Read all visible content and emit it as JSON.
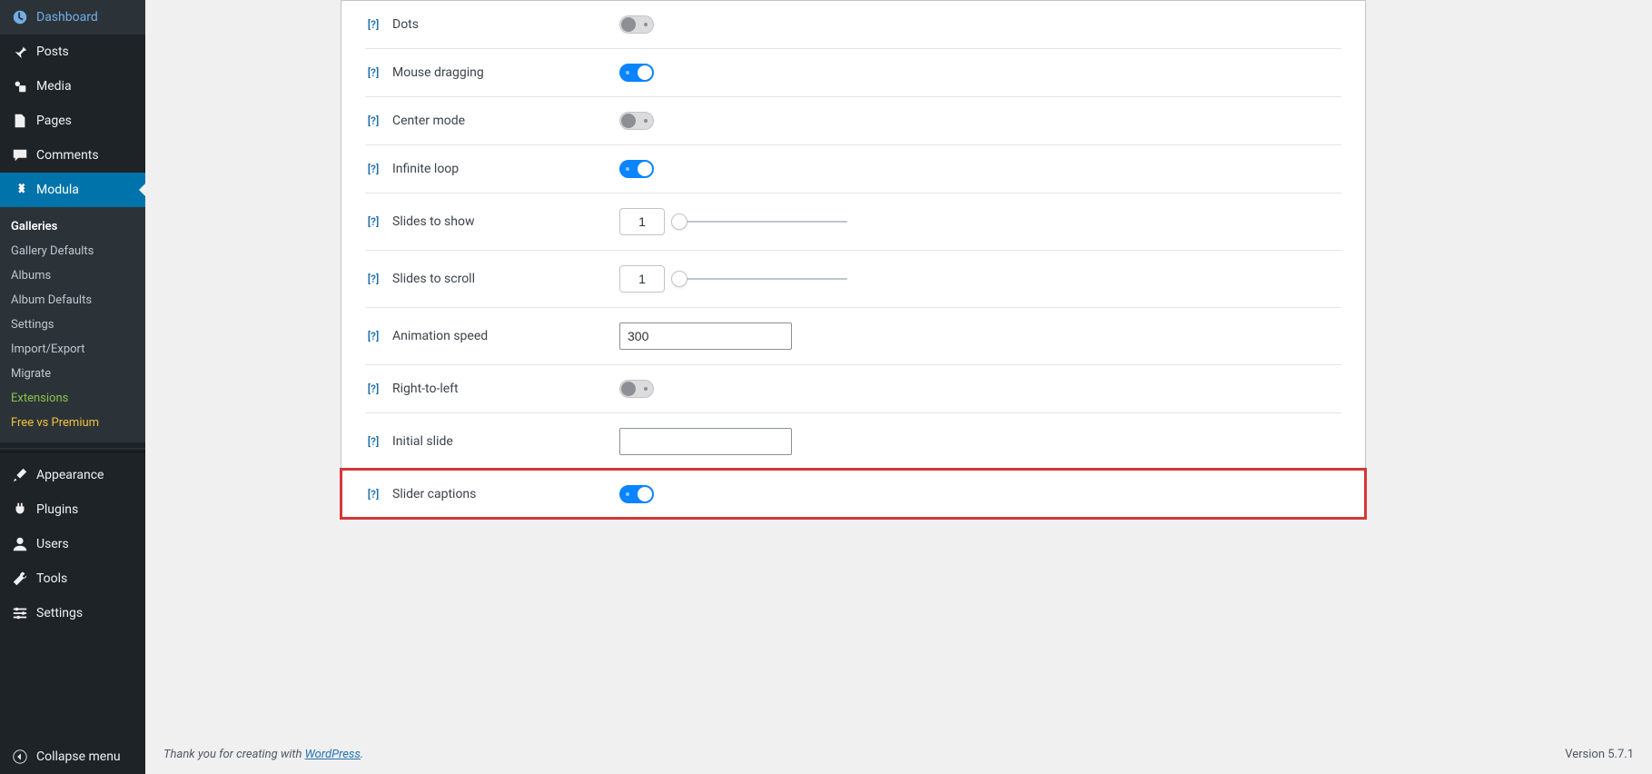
{
  "sidebar": {
    "dashboard": "Dashboard",
    "posts": "Posts",
    "media": "Media",
    "pages": "Pages",
    "comments": "Comments",
    "modula": "Modula",
    "submenu": {
      "galleries": "Galleries",
      "gallery_defaults": "Gallery Defaults",
      "albums": "Albums",
      "album_defaults": "Album Defaults",
      "settings": "Settings",
      "import_export": "Import/Export",
      "migrate": "Migrate",
      "extensions": "Extensions",
      "free_vs_premium": "Free vs Premium"
    },
    "appearance": "Appearance",
    "plugins": "Plugins",
    "users": "Users",
    "tools": "Tools",
    "settings": "Settings",
    "collapse": "Collapse menu"
  },
  "settings_rows": {
    "help_label": "[?]",
    "dots": "Dots",
    "mouse_dragging": "Mouse dragging",
    "center_mode": "Center mode",
    "infinite_loop": "Infinite loop",
    "slides_to_show": "Slides to show",
    "slides_to_scroll": "Slides to scroll",
    "animation_speed": "Animation speed",
    "rtl": "Right-to-left",
    "initial_slide": "Initial slide",
    "slider_captions": "Slider captions"
  },
  "values": {
    "dots_on": false,
    "mouse_dragging_on": true,
    "center_mode_on": false,
    "infinite_loop_on": true,
    "slides_to_show": "1",
    "slides_to_scroll": "1",
    "animation_speed": "300",
    "rtl_on": false,
    "initial_slide": "",
    "slider_captions_on": true
  },
  "footer": {
    "thank_you_prefix": "Thank you for creating with ",
    "wordpress": "WordPress",
    "thank_you_suffix": ".",
    "version": "Version 5.7.1"
  }
}
